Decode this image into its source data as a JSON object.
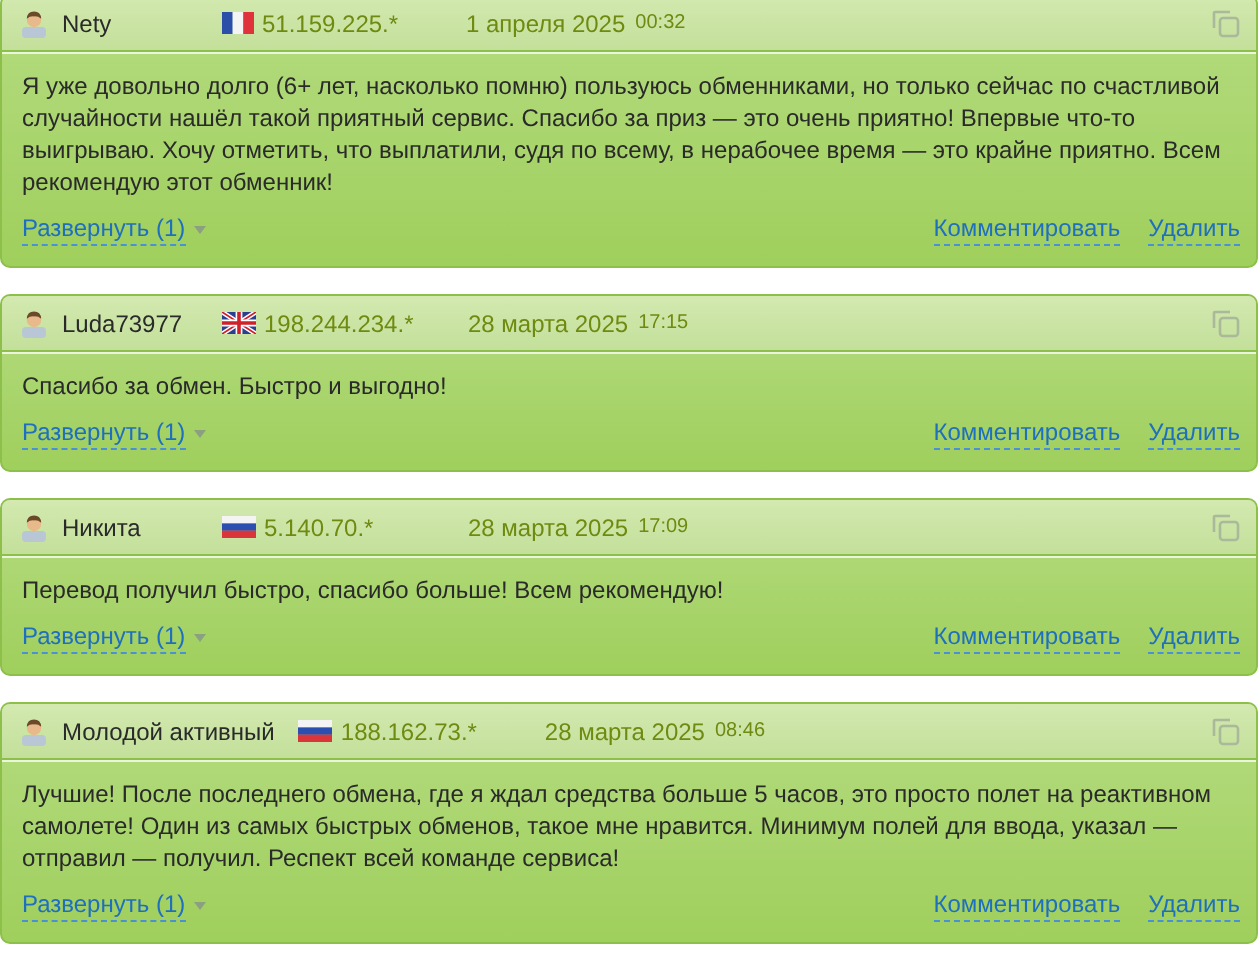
{
  "reviews": [
    {
      "author": "Nety",
      "kind": "fr",
      "ip": "51.159.225.*",
      "date": "1 апреля 2025",
      "time": "00:32",
      "text": "Я уже довольно долго (6+ лет, насколько помню) пользуюсь обменниками, но только сейчас по счастливой случайности нашёл такой приятный сервис. Спасибо за приз — это очень приятно! Впервые что-то выигрываю. Хочу отметить, что выплатили, судя по всему, в нерабочее время — это крайне приятно. Всем рекомендую этот обменник!",
      "expand": "Развернуть (1)",
      "comment": "Комментировать",
      "delete": "Удалить"
    },
    {
      "author": "Luda73977",
      "kind": "gb",
      "ip": "198.244.234.*",
      "date": "28 марта 2025",
      "time": "17:15",
      "text": "Спасибо за обмен. Быстро и выгодно!",
      "expand": "Развернуть (1)",
      "comment": "Комментировать",
      "delete": "Удалить"
    },
    {
      "author": "Никита",
      "kind": "ru",
      "ip": "5.140.70.*",
      "date": "28 марта 2025",
      "time": "17:09",
      "text": "Перевод получил быстро, спасибо больше! Всем рекомендую!",
      "expand": "Развернуть (1)",
      "comment": "Комментировать",
      "delete": "Удалить"
    },
    {
      "author": "Молодой активный",
      "kind": "ru",
      "ip": "188.162.73.*",
      "date": "28 марта 2025",
      "time": "08:46",
      "text": "Лучшие! После последнего обмена, где я ждал средства больше 5 часов, это просто полет на реактивном самолете! Один из самых быстрых обменов, такое мне нравится. Минимум полей для ввода, указал — отправил — получил. Респект всей команде сервиса!",
      "expand": "Развернуть (1)",
      "comment": "Комментировать",
      "delete": "Удалить"
    }
  ]
}
